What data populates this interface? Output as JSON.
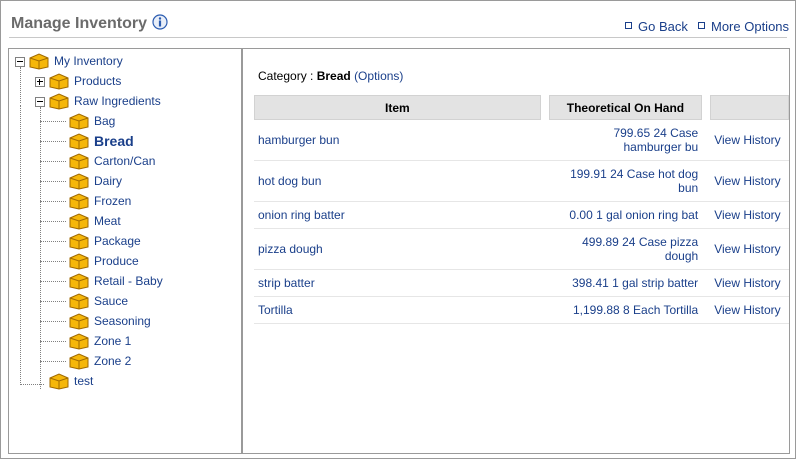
{
  "header": {
    "title": "Manage Inventory",
    "links": {
      "go_back": "Go Back",
      "more_options": "More Options"
    }
  },
  "icons": {
    "info": "info-icon",
    "tree_node": "box-icon"
  },
  "colors": {
    "link": "#1a3f8a",
    "title": "#6b6b6b",
    "table_header_bg": "#e3e3e3",
    "box_icon": "#f5b70a"
  },
  "tree": {
    "root": "My Inventory",
    "products": "Products",
    "raw_ingredients": "Raw Ingredients",
    "children": [
      "Bag",
      "Bread",
      "Carton/Can",
      "Dairy",
      "Frozen",
      "Meat",
      "Package",
      "Produce",
      "Retail - Baby",
      "Sauce",
      "Seasoning",
      "Zone 1",
      "Zone 2"
    ],
    "selected": "Bread",
    "test": "test"
  },
  "content": {
    "category_prefix": "Category : ",
    "category_name": "Bread",
    "options_label": "(Options)",
    "table": {
      "headers": [
        "Item",
        "Theoretical On Hand",
        ""
      ],
      "rows": [
        {
          "item": "hamburger bun",
          "on_hand_1": "799.65 24 Case",
          "on_hand_2": "hamburger bu",
          "action": "View History"
        },
        {
          "item": "hot dog bun",
          "on_hand_1": "199.91 24 Case hot dog",
          "on_hand_2": "bun",
          "action": "View History"
        },
        {
          "item": "onion ring batter",
          "on_hand_1": "0.00 1 gal onion ring bat",
          "on_hand_2": "",
          "action": "View History"
        },
        {
          "item": "pizza dough",
          "on_hand_1": "499.89 24 Case pizza",
          "on_hand_2": "dough",
          "action": "View History"
        },
        {
          "item": "strip batter",
          "on_hand_1": "398.41 1 gal strip batter",
          "on_hand_2": "",
          "action": "View History"
        },
        {
          "item": "Tortilla",
          "on_hand_1": "1,199.88 8 Each Tortilla",
          "on_hand_2": "",
          "action": "View History"
        }
      ]
    }
  }
}
